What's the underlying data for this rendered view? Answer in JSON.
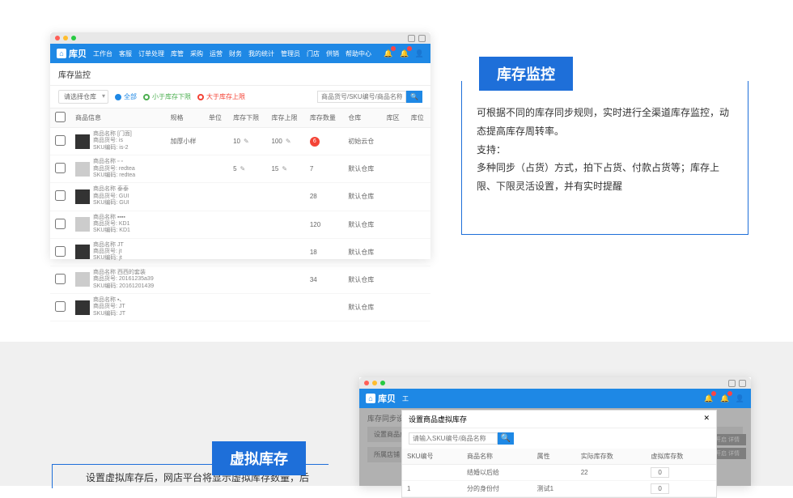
{
  "brand": "库贝",
  "nav": [
    "工作台",
    "客服",
    "订单处理",
    "库管",
    "采购",
    "运营",
    "财务",
    "我的统计",
    "管理员",
    "门店",
    "供销",
    "帮助中心"
  ],
  "page1": {
    "title": "库存监控",
    "filter_select": "请选择仓库",
    "f_all": "全部",
    "f_low": "小于库存下限",
    "f_high": "大于库存上限",
    "search_ph": "商品货号/SKU编号/商品名称",
    "headers": [
      "",
      "商品信息",
      "规格",
      "单位",
      "库存下限",
      "库存上限",
      "库存数量",
      "仓库",
      "库区",
      "库位"
    ],
    "rows": [
      {
        "name": "商品名称 [门面]",
        "sku": "商品货号: is",
        "code": "SKU编码: is-2",
        "spec": "加厚小样",
        "low": "10",
        "high": "100",
        "qty": "6",
        "qty_alert": true,
        "wh": "初始云仓"
      },
      {
        "name": "商品名称 ▫ ▫",
        "sku": "商品货号: redtea",
        "code": "SKU编码: redtea",
        "spec": "",
        "low": "5",
        "high": "15",
        "qty": "7",
        "wh": "默认仓库"
      },
      {
        "name": "商品名称 泰泰",
        "sku": "商品货号: GUI",
        "code": "SKU编码: GUI",
        "spec": "",
        "low": "",
        "high": "",
        "qty": "28",
        "wh": "默认仓库"
      },
      {
        "name": "商品名称 ▪▪▪▪",
        "sku": "商品货号: KD1",
        "code": "SKU编码: KD1",
        "spec": "",
        "low": "",
        "high": "",
        "qty": "120",
        "wh": "默认仓库"
      },
      {
        "name": "商品名称 JT",
        "sku": "商品货号: jt",
        "code": "SKU编码: jt",
        "spec": "",
        "low": "",
        "high": "",
        "qty": "18",
        "wh": "默认仓库"
      },
      {
        "name": "商品名称 西西的套装",
        "sku": "商品货号: 20161235a39",
        "code": "SKU编码: 20161201439",
        "spec": "",
        "low": "",
        "high": "",
        "qty": "34",
        "wh": "默认仓库"
      },
      {
        "name": "商品名称 ▪、",
        "sku": "商品货号: JT",
        "code": "SKU编码: JT",
        "spec": "",
        "low": "",
        "high": "",
        "qty": "",
        "wh": "默认仓库"
      }
    ]
  },
  "feature1": {
    "title": "库存监控",
    "desc": "可根据不同的库存同步规则，实时进行全渠道库存监控，动态提高库存周转率。\n支持：\n多种同步（占货）方式，拍下占货、付款占货等；库存上限、下限灵活设置，并有实时提醒"
  },
  "feature2": {
    "title": "虚拟库存",
    "partial": "设置虚拟库存后，网店平台将显示虚拟库存数量，后"
  },
  "page2": {
    "title": "库存同步设置",
    "subtitle": "设置商品虚拟库存",
    "sidebar": [
      "所属店铺"
    ],
    "modal_title": "设置商品虚拟库存",
    "modal_search_ph": "请输入SKU编号/商品名称",
    "modal_headers": [
      "SKU编号",
      "商品名称",
      "属性",
      "实际库存数",
      "虚拟库存数"
    ],
    "modal_rows": [
      {
        "sku": "",
        "name": "结婚以后给",
        "attr": "",
        "real": "22",
        "virt": "0"
      },
      {
        "sku": "1",
        "name": "分的身份付",
        "attr": "测试1",
        "real": "",
        "virt": "0"
      }
    ],
    "side_btns": [
      "开启  详情",
      "开启  详情"
    ]
  }
}
